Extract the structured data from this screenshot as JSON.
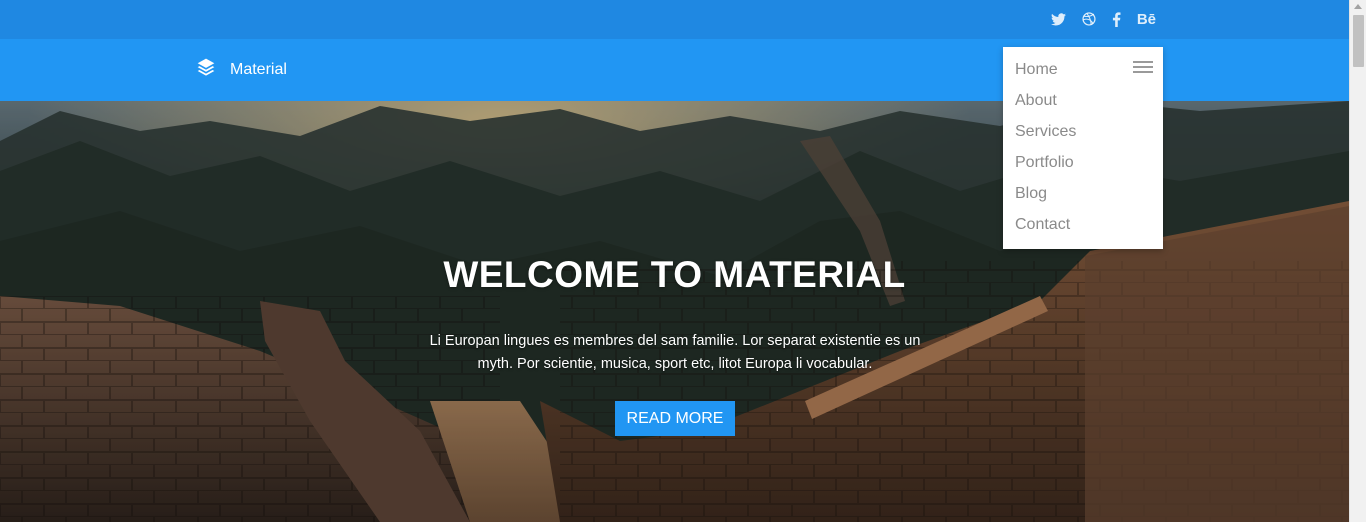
{
  "social": {
    "icons": [
      "twitter-icon",
      "dribbble-icon",
      "facebook-icon",
      "behance-icon"
    ],
    "behance_label": "Bē"
  },
  "brand": {
    "name": "Material",
    "icon": "layers-icon"
  },
  "menu": {
    "items": [
      "Home",
      "About",
      "Services",
      "Portfolio",
      "Blog",
      "Contact"
    ]
  },
  "hero": {
    "title": "WELCOME TO MATERIAL",
    "text": "Li Europan lingues es membres del sam familie. Lor separat existentie es un myth. Por scientie, musica, sport etc, litot Europa li vocabular.",
    "button": "READ MORE"
  },
  "colors": {
    "topbar": "#1f88e2",
    "navbar": "#2196f3",
    "accent": "#2196f3"
  }
}
